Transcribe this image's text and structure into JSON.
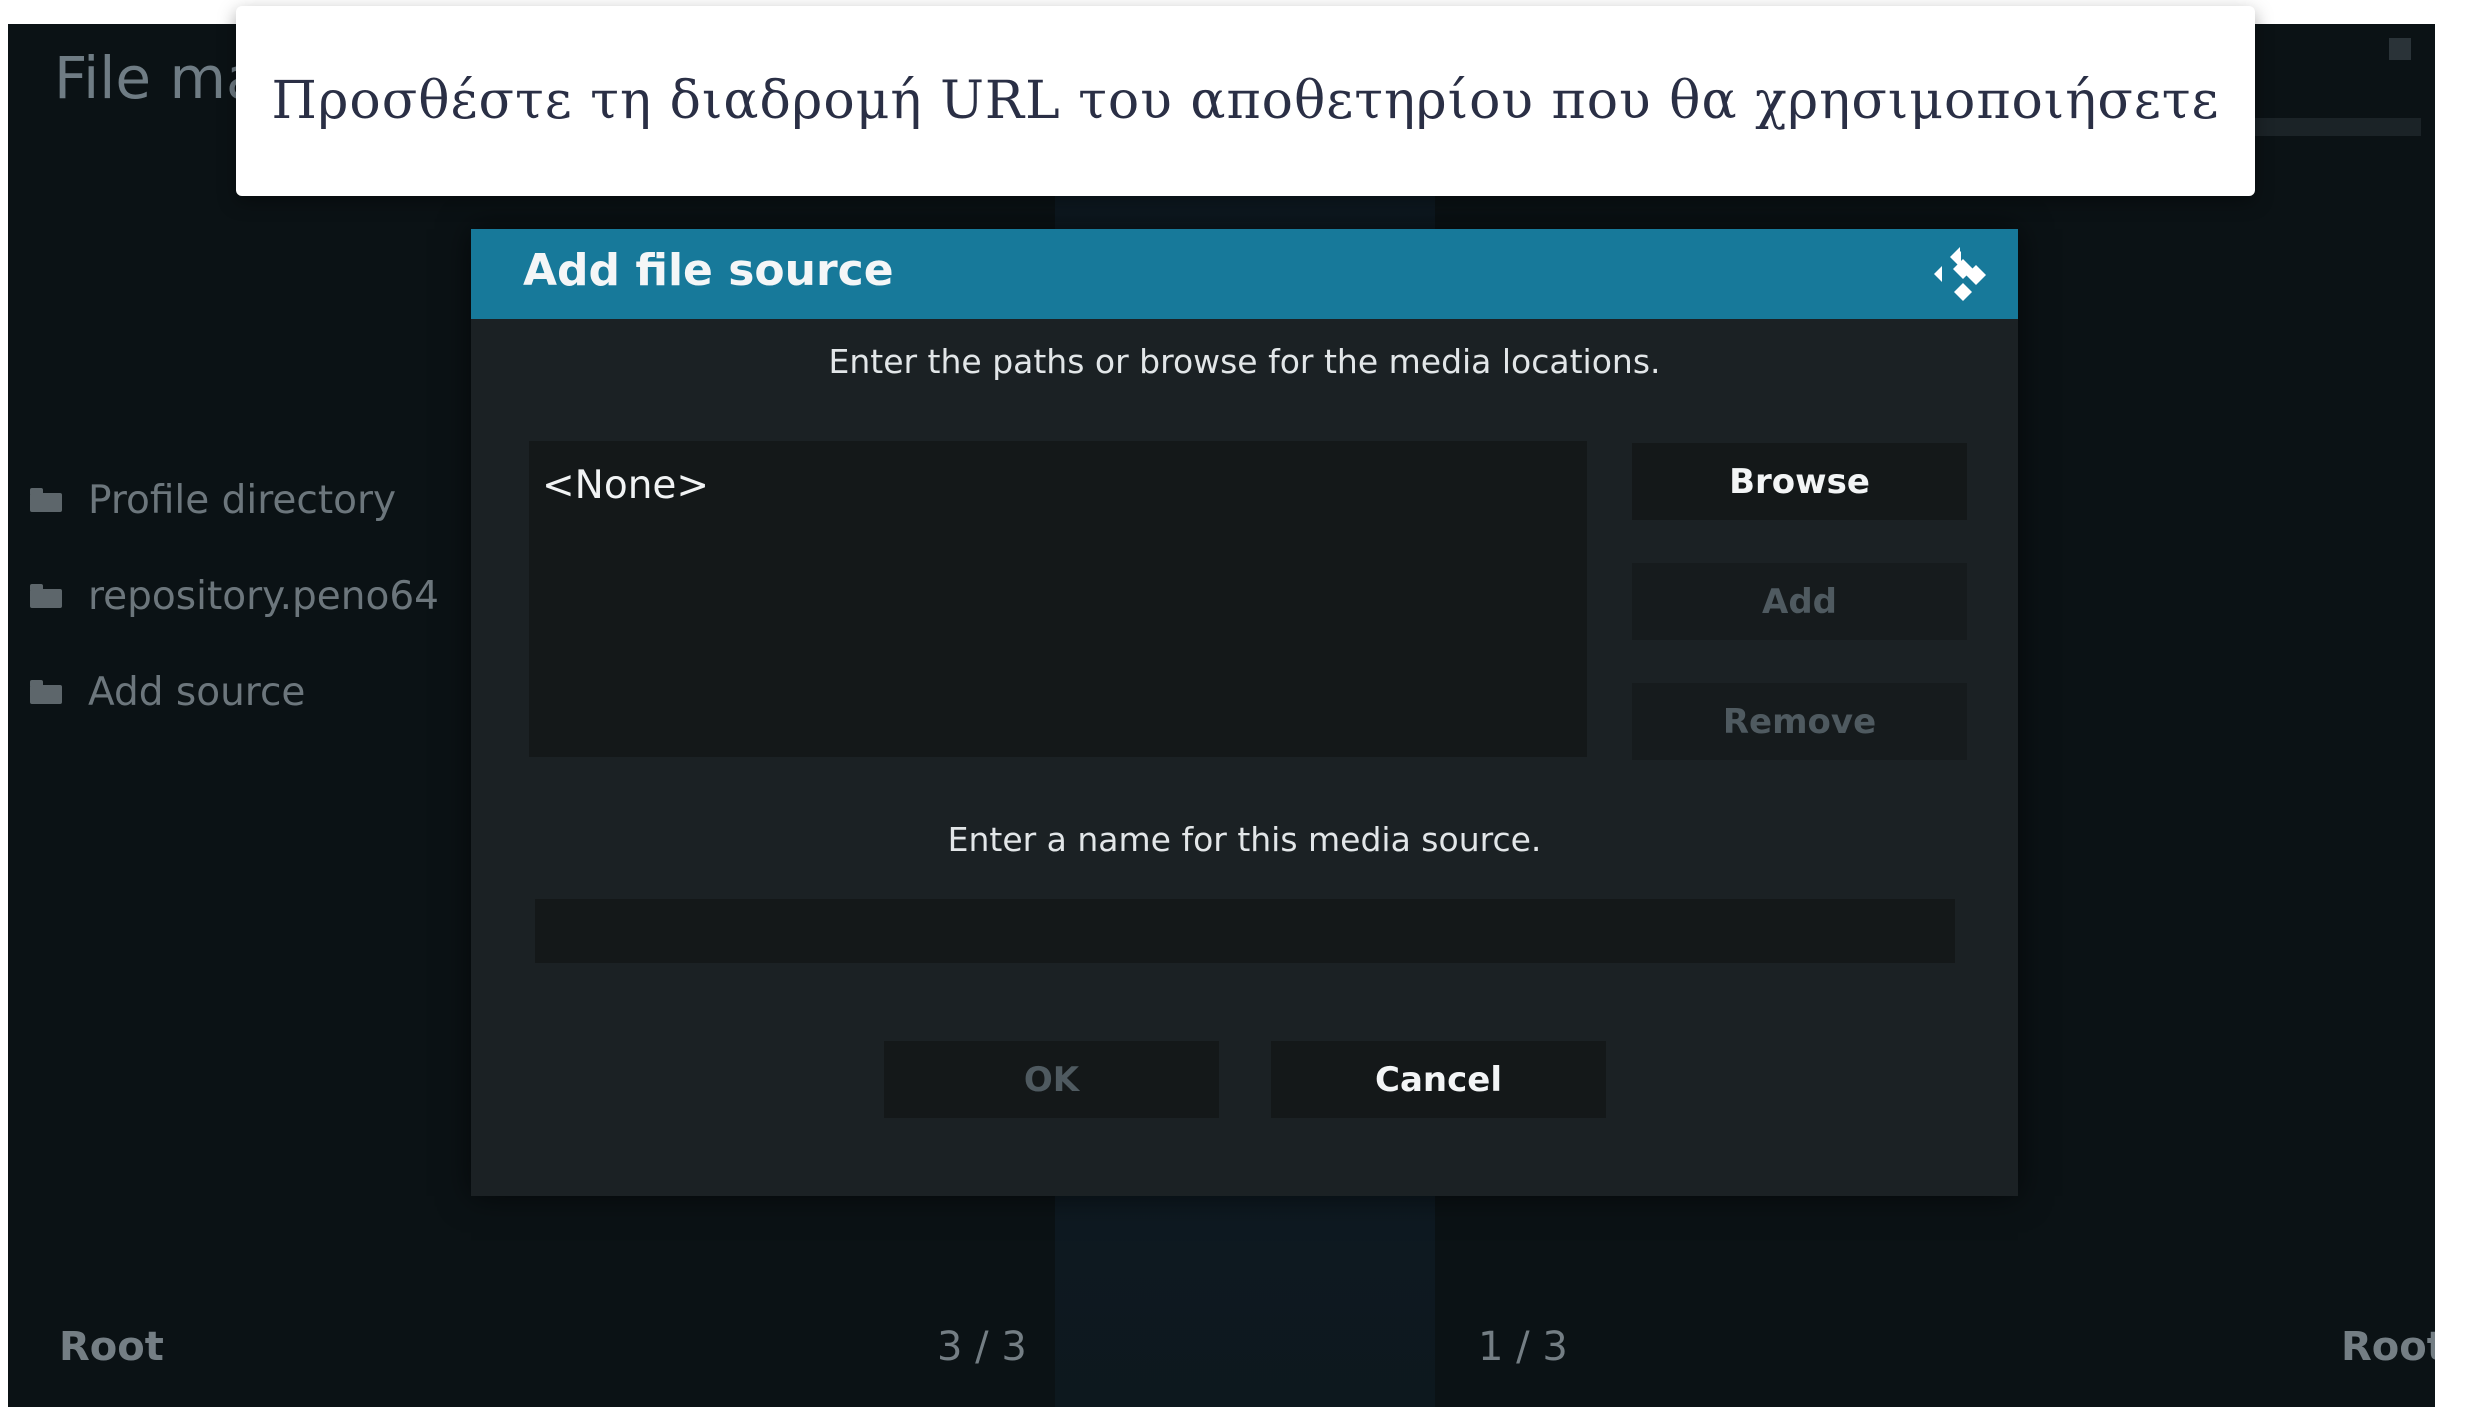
{
  "banner": {
    "text": "Προσθέστε τη διαδρομή URL του αποθετηρίου που θα χρησιμοποιήσετε"
  },
  "background": {
    "app_title": "File ma",
    "list_items": [
      {
        "label": "Profile directory",
        "icon": "folder-icon"
      },
      {
        "label": "repository.peno64",
        "icon": "folder-icon"
      },
      {
        "label": "Add source",
        "icon": "folder-icon"
      }
    ],
    "footer": {
      "left_label": "Root",
      "left_count": "3 / 3",
      "right_count": "1 / 3",
      "right_label": "Root"
    }
  },
  "dialog": {
    "title": "Add file source",
    "logo_icon": "kodi-logo-icon",
    "instruction_paths": "Enter the paths or browse for the media locations.",
    "paths_value": "<None>",
    "browse_label": "Browse",
    "add_label": "Add",
    "remove_label": "Remove",
    "instruction_name": "Enter a name for this media source.",
    "name_value": "",
    "ok_label": "OK",
    "cancel_label": "Cancel"
  },
  "colors": {
    "header_accent": "#17799a",
    "dialog_bg": "#1b2124",
    "screen_bg": "#0b1215",
    "disabled_text": "#4f5a60"
  }
}
